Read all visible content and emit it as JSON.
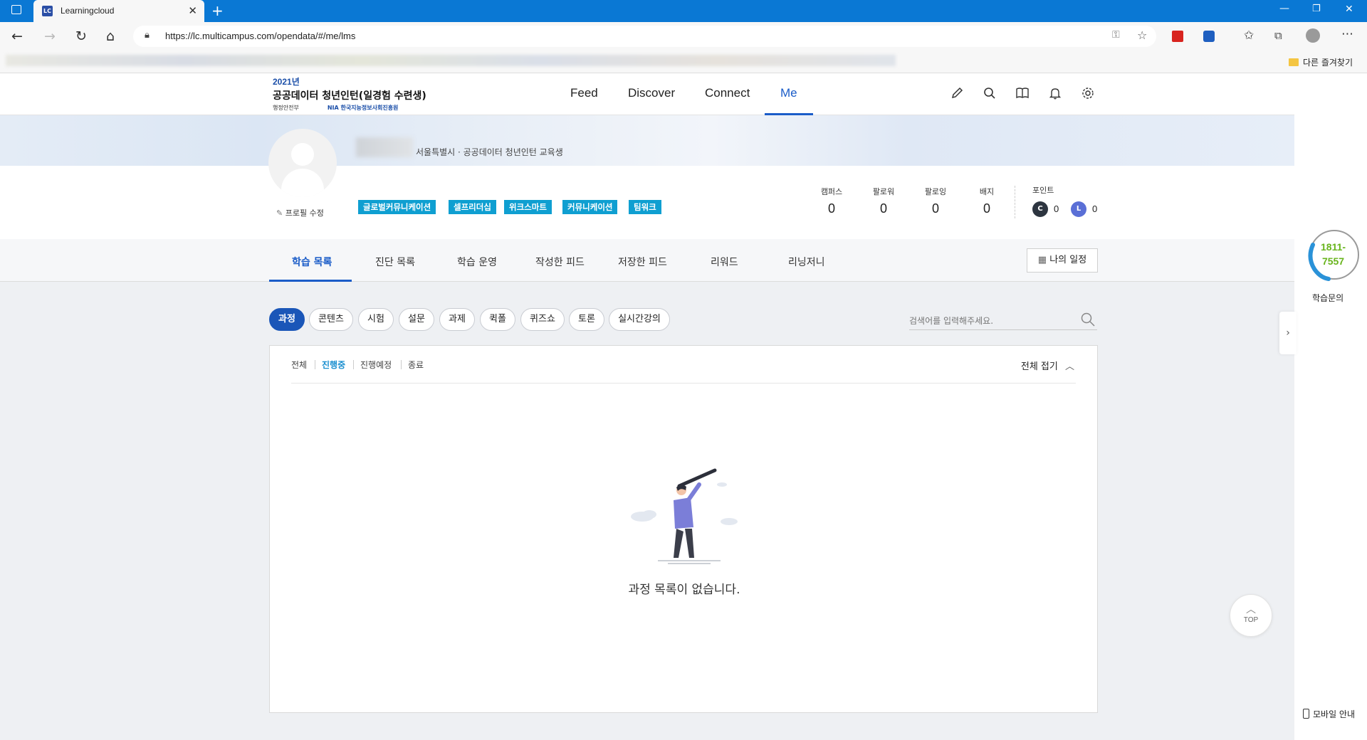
{
  "browser": {
    "tab_title": "Learningcloud",
    "tab_favicon": "LC",
    "url": "https://lc.multicampus.com/opendata/#/me/lms",
    "other_favorites": "다른 즐겨찾기"
  },
  "header": {
    "logo_year": "2021년",
    "logo_name": "공공데이터 청년인턴(일경험 수련생)",
    "logo_org1": "행정안전부",
    "logo_org2": "NIA 한국지능정보사회진흥원",
    "nav": [
      {
        "label": "Feed"
      },
      {
        "label": "Discover"
      },
      {
        "label": "Connect"
      },
      {
        "label": "Me"
      }
    ],
    "active_nav": "Me"
  },
  "profile": {
    "location": "서울특별시 · 공공데이터 청년인턴 교육생",
    "edit_label": "프로필 수정",
    "tags": [
      "글로벌커뮤니케이션",
      "셀프리더십",
      "위크스마트",
      "커뮤니케이션",
      "팀워크"
    ],
    "stats": [
      {
        "label": "캠퍼스",
        "value": "0"
      },
      {
        "label": "팔로워",
        "value": "0"
      },
      {
        "label": "팔로잉",
        "value": "0"
      },
      {
        "label": "배지",
        "value": "0"
      }
    ],
    "points_label": "포인트",
    "points": [
      {
        "icon": "C",
        "value": "0",
        "color": "#2d3540"
      },
      {
        "icon": "L",
        "value": "0",
        "color": "#5a6fd6"
      }
    ]
  },
  "tabs": {
    "items": [
      "학습 목록",
      "진단 목록",
      "학습 운영",
      "작성한 피드",
      "저장한 피드",
      "리워드",
      "리닝저니"
    ],
    "active": "학습 목록",
    "schedule_button": "나의 일정"
  },
  "filters": {
    "chips": [
      "과정",
      "콘텐츠",
      "시험",
      "설문",
      "과제",
      "퀵폴",
      "퀴즈쇼",
      "토론",
      "실시간강의"
    ],
    "active_chip": "과정",
    "search_placeholder": "검색어를 입력해주세요."
  },
  "panel": {
    "status_filters": [
      "전체",
      "진행중",
      "진행예정",
      "종료"
    ],
    "active_status": "진행중",
    "collapse_label": "전체 접기",
    "empty_message": "과정 목록이 없습니다."
  },
  "side": {
    "phone_line1": "1811-",
    "phone_line2": "7557",
    "phone_label": "학습문의",
    "mobile_guide": "모바일 안내",
    "top_label": "TOP"
  },
  "colors": {
    "accent": "#1a5cc8",
    "tag": "#0f9fd1",
    "titlebar": "#0a78d4",
    "phone_green": "#68b41c"
  }
}
